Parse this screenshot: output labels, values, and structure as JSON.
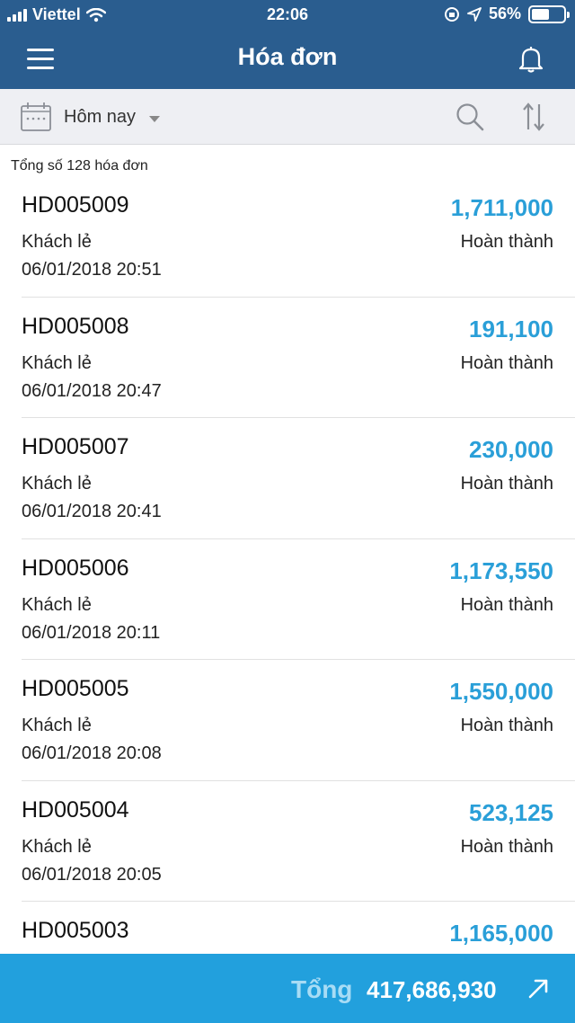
{
  "status_bar": {
    "carrier": "Viettel",
    "time": "22:06",
    "battery": "56%",
    "battery_level": 0.56
  },
  "nav": {
    "title": "Hóa đơn"
  },
  "filter": {
    "date_range": "Hôm nay"
  },
  "summary": {
    "count_text": "Tổng số 128 hóa đơn"
  },
  "invoices": [
    {
      "code": "HD005009",
      "amount": "1,711,000",
      "customer": "Khách lẻ",
      "status": "Hoàn thành",
      "datetime": "06/01/2018 20:51"
    },
    {
      "code": "HD005008",
      "amount": "191,100",
      "customer": "Khách lẻ",
      "status": "Hoàn thành",
      "datetime": "06/01/2018 20:47"
    },
    {
      "code": "HD005007",
      "amount": "230,000",
      "customer": "Khách lẻ",
      "status": "Hoàn thành",
      "datetime": "06/01/2018 20:41"
    },
    {
      "code": "HD005006",
      "amount": "1,173,550",
      "customer": "Khách lẻ",
      "status": "Hoàn thành",
      "datetime": "06/01/2018 20:11"
    },
    {
      "code": "HD005005",
      "amount": "1,550,000",
      "customer": "Khách lẻ",
      "status": "Hoàn thành",
      "datetime": "06/01/2018 20:08"
    },
    {
      "code": "HD005004",
      "amount": "523,125",
      "customer": "Khách lẻ",
      "status": "Hoàn thành",
      "datetime": "06/01/2018 20:05"
    },
    {
      "code": "HD005003",
      "amount": "1,165,000",
      "customer": "",
      "status": "",
      "datetime": ""
    }
  ],
  "footer": {
    "total_label": "Tổng",
    "total_value": "417,686,930"
  },
  "colors": {
    "header_bg": "#2a5d8f",
    "amount": "#2a9fd8",
    "footer_bg": "#22a0dd"
  },
  "icons": {
    "menu": "hamburger-menu-icon",
    "bell": "bell-icon",
    "calendar": "calendar-icon",
    "search": "search-icon",
    "sort": "sort-arrows-icon",
    "expand": "arrow-up-right-icon"
  }
}
